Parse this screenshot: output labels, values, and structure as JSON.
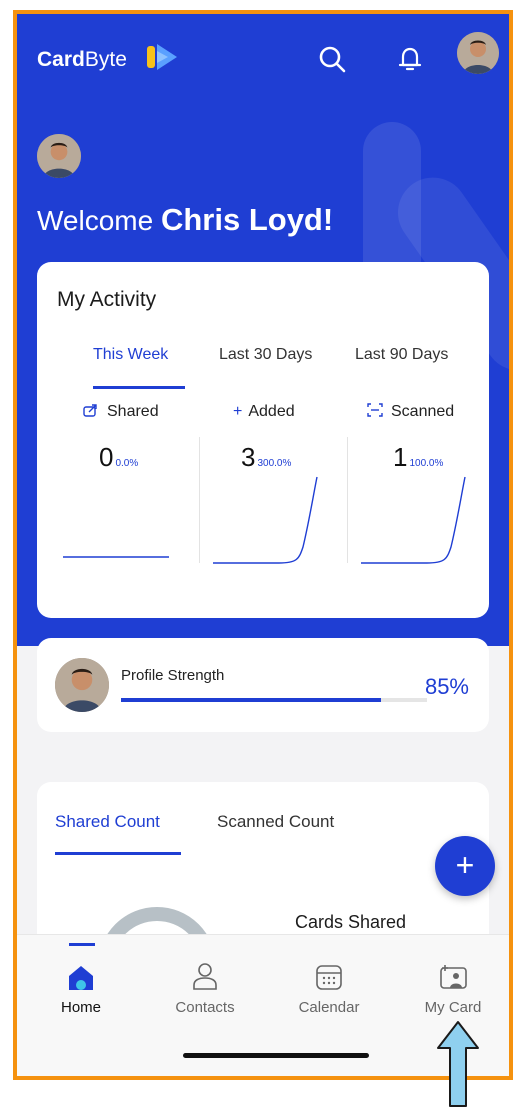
{
  "header": {
    "brand_bold": "Card",
    "brand_light": "Byte",
    "icons": [
      "search-icon",
      "bell-icon",
      "avatar"
    ]
  },
  "welcome": {
    "prefix": "Welcome ",
    "name": "Chris Loyd!"
  },
  "activity": {
    "title": "My Activity",
    "tabs": [
      {
        "label": "This Week",
        "active": true
      },
      {
        "label": "Last 30 Days",
        "active": false
      },
      {
        "label": "Last 90 Days",
        "active": false
      }
    ],
    "metrics": [
      {
        "icon": "share-icon",
        "label": "Shared",
        "value": "0",
        "change": "0.0%"
      },
      {
        "icon": "plus-icon",
        "label": "Added",
        "value": "3",
        "change": "300.0%"
      },
      {
        "icon": "scan-icon",
        "label": "Scanned",
        "value": "1",
        "change": "100.0%"
      }
    ]
  },
  "profile_strength": {
    "label": "Profile Strength",
    "percent_text": "85%",
    "fill_fraction": 0.85
  },
  "counts": {
    "tabs": [
      {
        "label": "Shared Count",
        "active": true
      },
      {
        "label": "Scanned Count",
        "active": false
      }
    ],
    "cards_shared_label": "Cards Shared"
  },
  "fab": {
    "label": "+"
  },
  "bottom_nav": {
    "items": [
      {
        "icon": "home-icon",
        "label": "Home",
        "active": true
      },
      {
        "icon": "contacts-icon",
        "label": "Contacts",
        "active": false
      },
      {
        "icon": "calendar-icon",
        "label": "Calendar",
        "active": false
      },
      {
        "icon": "my-card-icon",
        "label": "My Card",
        "active": false
      }
    ]
  },
  "colors": {
    "brand_blue": "#1f3ed3",
    "frame_orange": "#f5920f",
    "logo_yellow": "#f7c21b",
    "arrow_blue": "#8fd0ef"
  }
}
